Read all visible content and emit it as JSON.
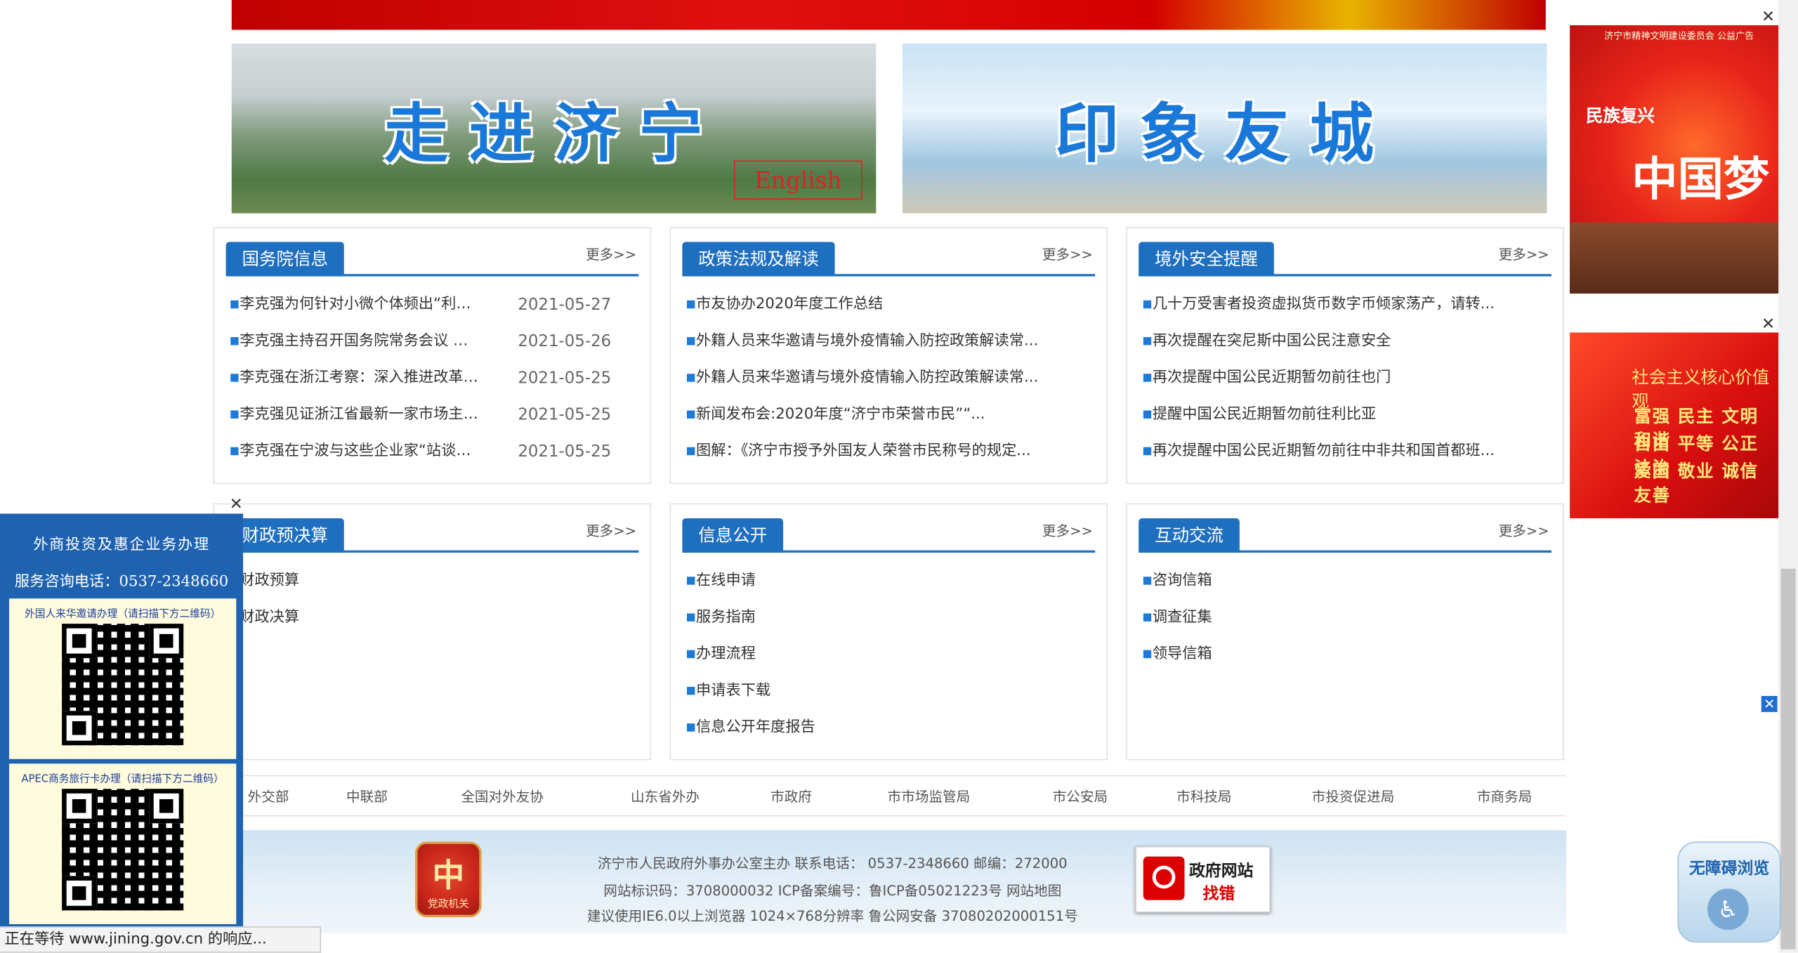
{
  "banners": {
    "left_title": "走进济宁",
    "left_badge": "English",
    "right_title": "印象友城"
  },
  "panels": [
    {
      "title": "国务院信息",
      "more": "更多",
      "items": [
        {
          "title": "李克强为何针对小微个体频出“利…",
          "date": "2021-05-27"
        },
        {
          "title": "李克强主持召开国务院常务会议 部…",
          "date": "2021-05-26"
        },
        {
          "title": "李克强在浙江考察：深入推进改革 …",
          "date": "2021-05-25"
        },
        {
          "title": "李克强见证浙江省最新一家市场主…",
          "date": "2021-05-25"
        },
        {
          "title": "李克强在宁波与这些企业家“站谈…",
          "date": "2021-05-25"
        }
      ]
    },
    {
      "title": "政策法规及解读",
      "more": "更多",
      "items": [
        {
          "title": "市友协办2020年度工作总结"
        },
        {
          "title": "外籍人员来华邀请与境外疫情输入防控政策解读常..."
        },
        {
          "title": "外籍人员来华邀请与境外疫情输入防控政策解读常..."
        },
        {
          "title": "新闻发布会:2020年度“济宁市荣誉市民”“..."
        },
        {
          "title": "图解：《济宁市授予外国友人荣誉市民称号的规定..."
        }
      ]
    },
    {
      "title": "境外安全提醒",
      "more": "更多",
      "items": [
        {
          "title": "几十万受害者投资虚拟货币数字币倾家荡产，请转..."
        },
        {
          "title": "再次提醒在突尼斯中国公民注意安全"
        },
        {
          "title": "再次提醒中国公民近期暂勿前往也门"
        },
        {
          "title": "提醒中国公民近期暂勿前往利比亚"
        },
        {
          "title": "再次提醒中国公民近期暂勿前往中非共和国首都班..."
        }
      ]
    },
    {
      "title": "财政预决算",
      "more": "更多",
      "items": [
        {
          "title": "财政预算"
        },
        {
          "title": "财政决算"
        }
      ]
    },
    {
      "title": "信息公开",
      "more": "更多",
      "items": [
        {
          "title": "在线申请"
        },
        {
          "title": "服务指南"
        },
        {
          "title": "办理流程"
        },
        {
          "title": "申请表下载"
        },
        {
          "title": "信息公开年度报告"
        }
      ]
    },
    {
      "title": "互动交流",
      "more": "更多",
      "items": [
        {
          "title": "咨询信箱"
        },
        {
          "title": "调查征集"
        },
        {
          "title": "领导信箱"
        }
      ]
    }
  ],
  "links": [
    "外交部",
    "中联部",
    "全国对外友协",
    "山东省外办",
    "市政府",
    "市市场监管局",
    "市公安局",
    "市科技局",
    "市投资促进局",
    "市商务局"
  ],
  "footer": {
    "line1": "济宁市人民政府外事办公室主办  联系电话： 0537-2348660  邮编：272000",
    "line2": "网站标识码：3708000032  ICP备案编号：鲁ICP备05021223号  网站地图",
    "line3": "建议使用IE6.0以上浏览器  1024×768分辨率   鲁公网安备  37080202000151号",
    "emblem": "党政机关",
    "gov_btn_1": "政府网站",
    "gov_btn_2": "找错"
  },
  "left_float": {
    "title": "外商投资及惠企业务办理",
    "phone": "服务咨询电话：0537-2348660",
    "qr1_caption": "外国人来华邀请办理（请扫描下方二维码）",
    "qr2_caption": "APEC商务旅行卡办理（请扫描下方二维码）"
  },
  "right_ads": {
    "ad1_small": "济宁市精神文明建设委员会 公益广告",
    "ad1_line1": "民族复兴",
    "ad1_line2": "中国梦",
    "ad2_title": "社会主义核心价值观",
    "ad2_rows": [
      "富强 民主 文明 和谐",
      "自由 平等 公正 法治",
      "爱国 敬业 诚信 友善"
    ]
  },
  "accessibility": "无障碍浏览",
  "status_bar": "正在等待 www.jining.gov.cn 的响应..."
}
